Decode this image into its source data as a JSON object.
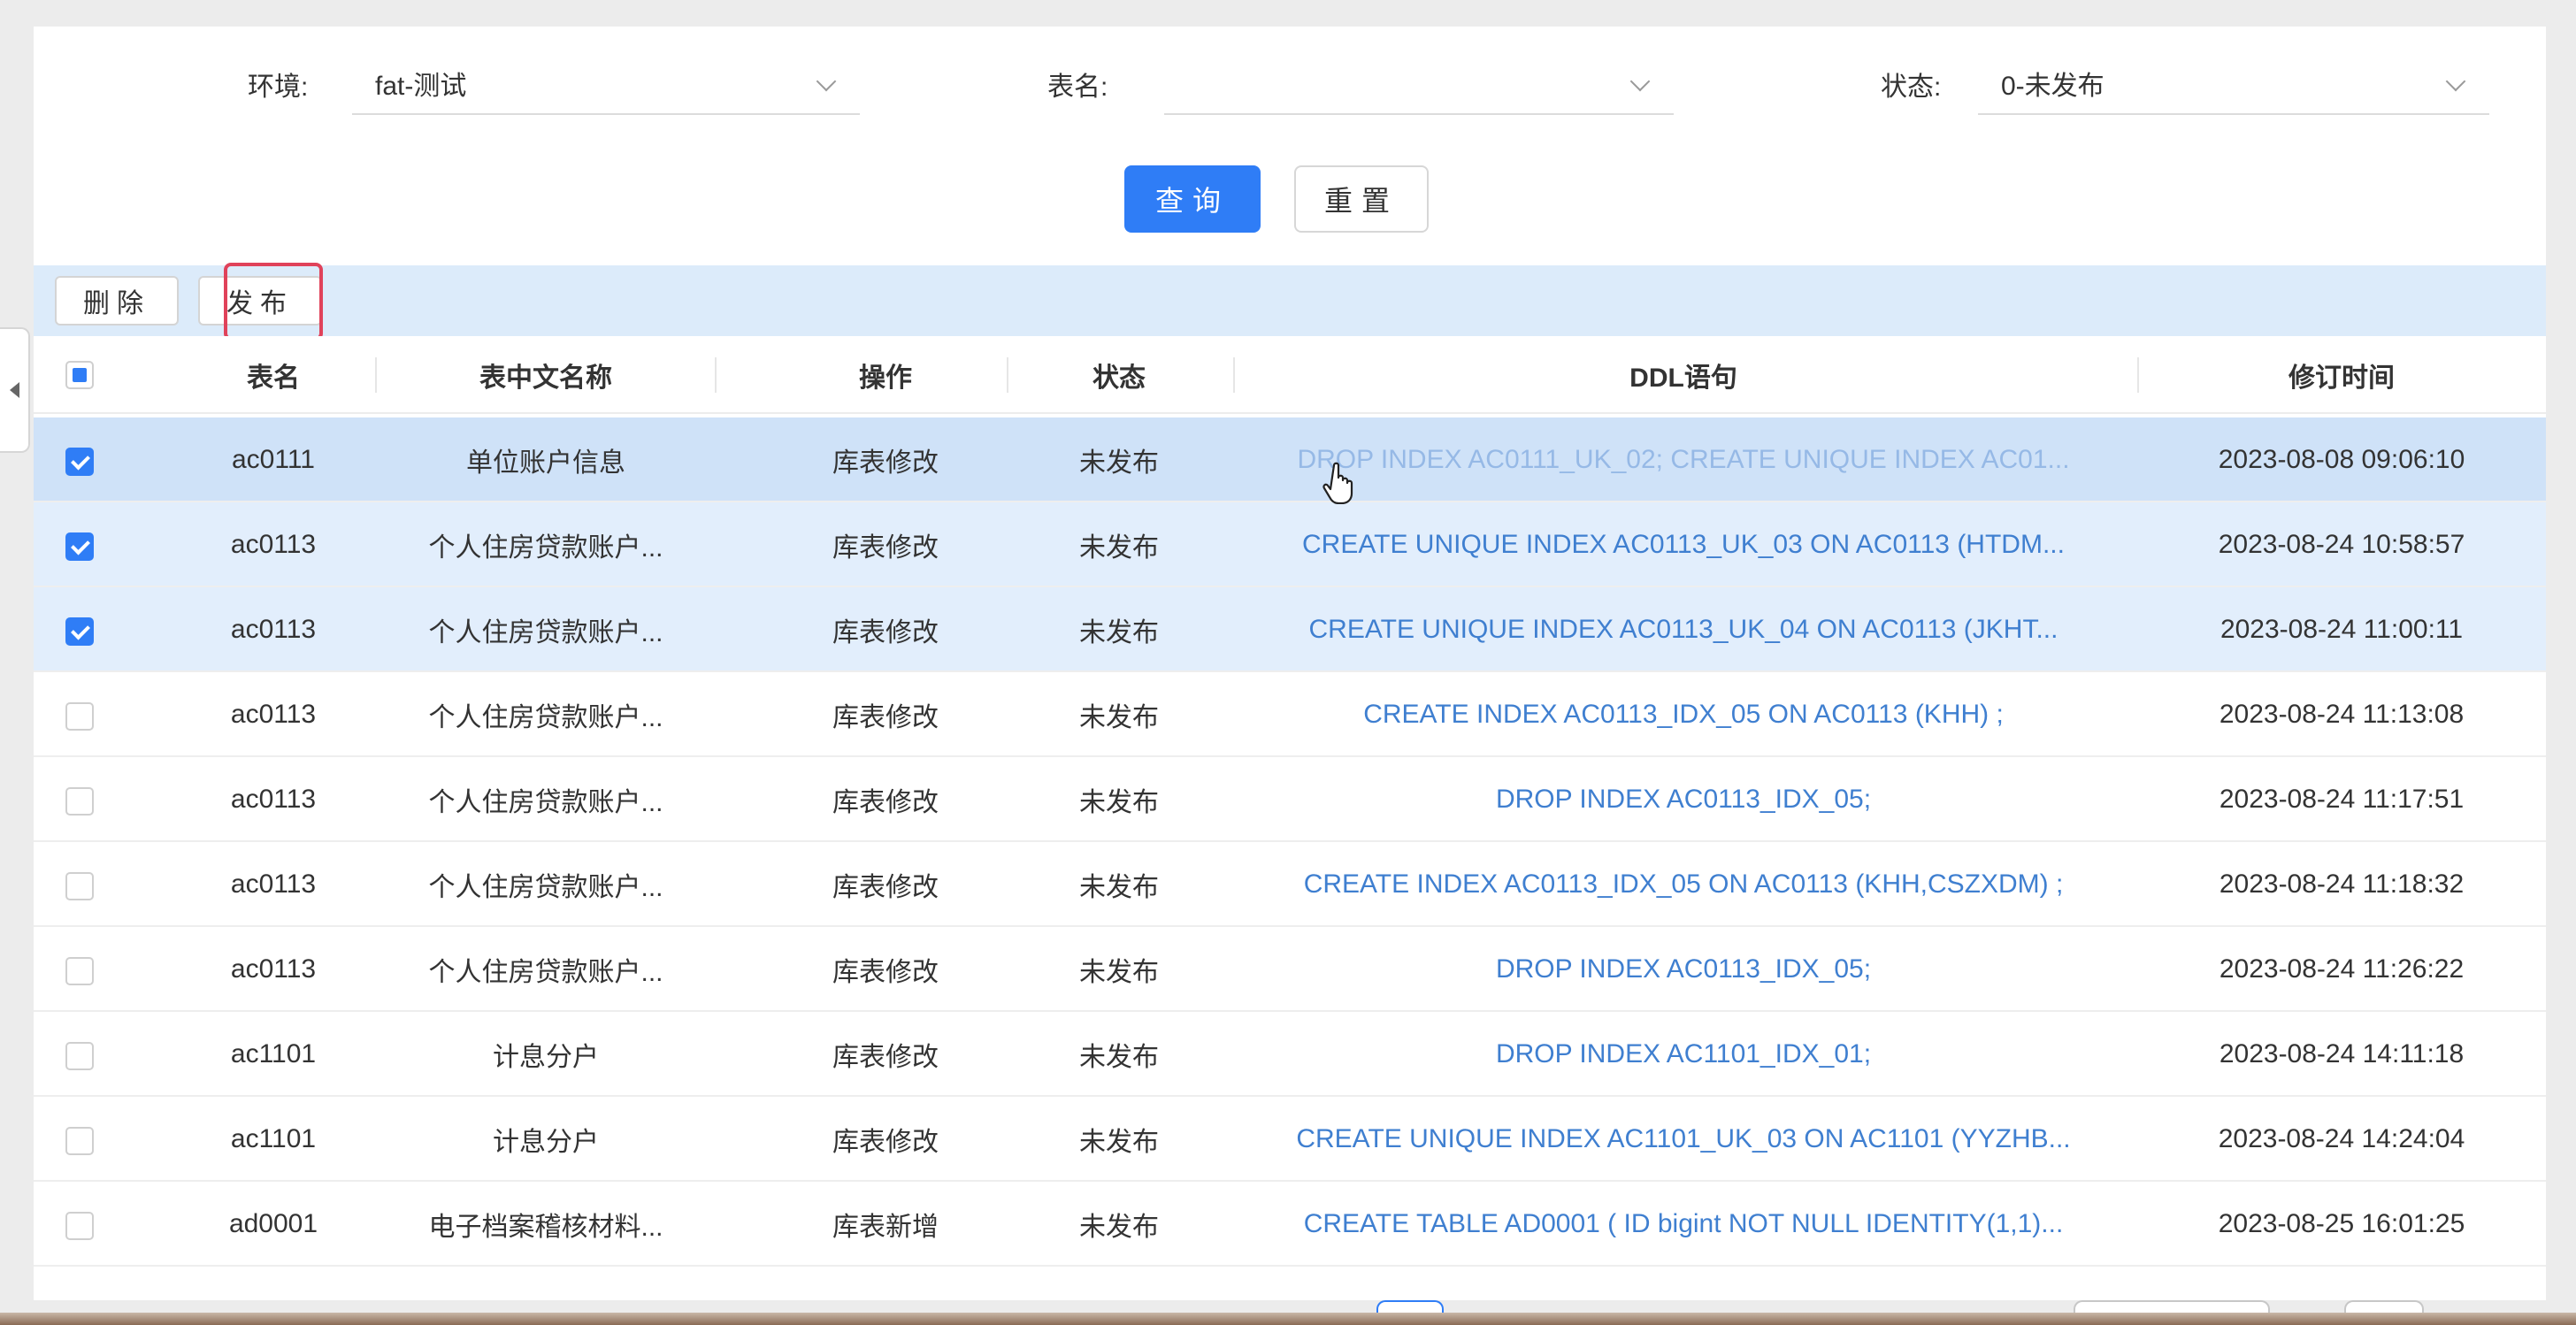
{
  "filters": {
    "env_label": "环境:",
    "env_value": "fat-测试",
    "table_label": "表名:",
    "table_value": "",
    "status_label": "状态:",
    "status_value": "0-未发布"
  },
  "actions": {
    "query": "查询",
    "reset": "重置"
  },
  "toolbar": {
    "delete": "删除",
    "publish": "发布"
  },
  "columns": [
    "表名",
    "表中文名称",
    "操作",
    "状态",
    "DDL语句",
    "修订时间"
  ],
  "rows": [
    {
      "table": "ac0111",
      "cn_name": "单位账户信息",
      "op": "库表修改",
      "status": "未发布",
      "ddl": "DROP INDEX AC0111_UK_02; CREATE UNIQUE INDEX AC01...",
      "time": "2023-08-08 09:06:10",
      "checked": true
    },
    {
      "table": "ac0113",
      "cn_name": "个人住房贷款账户...",
      "op": "库表修改",
      "status": "未发布",
      "ddl": "CREATE UNIQUE INDEX AC0113_UK_03 ON AC0113 (HTDM...",
      "time": "2023-08-24 10:58:57",
      "checked": true
    },
    {
      "table": "ac0113",
      "cn_name": "个人住房贷款账户...",
      "op": "库表修改",
      "status": "未发布",
      "ddl": "CREATE UNIQUE INDEX AC0113_UK_04 ON AC0113 (JKHT...",
      "time": "2023-08-24 11:00:11",
      "checked": true
    },
    {
      "table": "ac0113",
      "cn_name": "个人住房贷款账户...",
      "op": "库表修改",
      "status": "未发布",
      "ddl": "CREATE INDEX AC0113_IDX_05 ON AC0113 (KHH) ;",
      "time": "2023-08-24 11:13:08",
      "checked": false
    },
    {
      "table": "ac0113",
      "cn_name": "个人住房贷款账户...",
      "op": "库表修改",
      "status": "未发布",
      "ddl": "DROP INDEX AC0113_IDX_05;",
      "time": "2023-08-24 11:17:51",
      "checked": false
    },
    {
      "table": "ac0113",
      "cn_name": "个人住房贷款账户...",
      "op": "库表修改",
      "status": "未发布",
      "ddl": "CREATE INDEX AC0113_IDX_05 ON AC0113 (KHH,CSZXDM) ;",
      "time": "2023-08-24 11:18:32",
      "checked": false
    },
    {
      "table": "ac0113",
      "cn_name": "个人住房贷款账户...",
      "op": "库表修改",
      "status": "未发布",
      "ddl": "DROP INDEX AC0113_IDX_05;",
      "time": "2023-08-24 11:26:22",
      "checked": false
    },
    {
      "table": "ac1101",
      "cn_name": "计息分户",
      "op": "库表修改",
      "status": "未发布",
      "ddl": "DROP INDEX AC1101_IDX_01;",
      "time": "2023-08-24 14:11:18",
      "checked": false
    },
    {
      "table": "ac1101",
      "cn_name": "计息分户",
      "op": "库表修改",
      "status": "未发布",
      "ddl": "CREATE UNIQUE INDEX AC1101_UK_03 ON AC1101 (YYZHB...",
      "time": "2023-08-24 14:24:04",
      "checked": false
    },
    {
      "table": "ad0001",
      "cn_name": "电子档案稽核材料...",
      "op": "库表新增",
      "status": "未发布",
      "ddl": "CREATE TABLE AD0001 ( ID bigint NOT NULL IDENTITY(1,1)...",
      "time": "2023-08-25 16:01:25",
      "checked": false
    }
  ],
  "colors": {
    "primary": "#2f7df6",
    "ddl_link": "#3f7fd0",
    "highlight_border": "#e0425a",
    "row_selected": "#e2eefc"
  }
}
